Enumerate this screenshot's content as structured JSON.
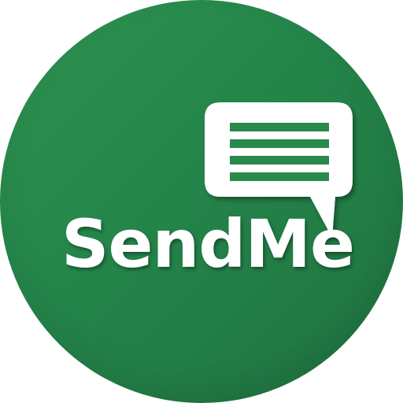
{
  "app": {
    "name": "SendMe"
  },
  "colors": {
    "background_light": "#2e9150",
    "background_dark": "#1f7140",
    "foreground": "#ffffff"
  },
  "icons": {
    "bubble": "speech-bubble-icon"
  }
}
